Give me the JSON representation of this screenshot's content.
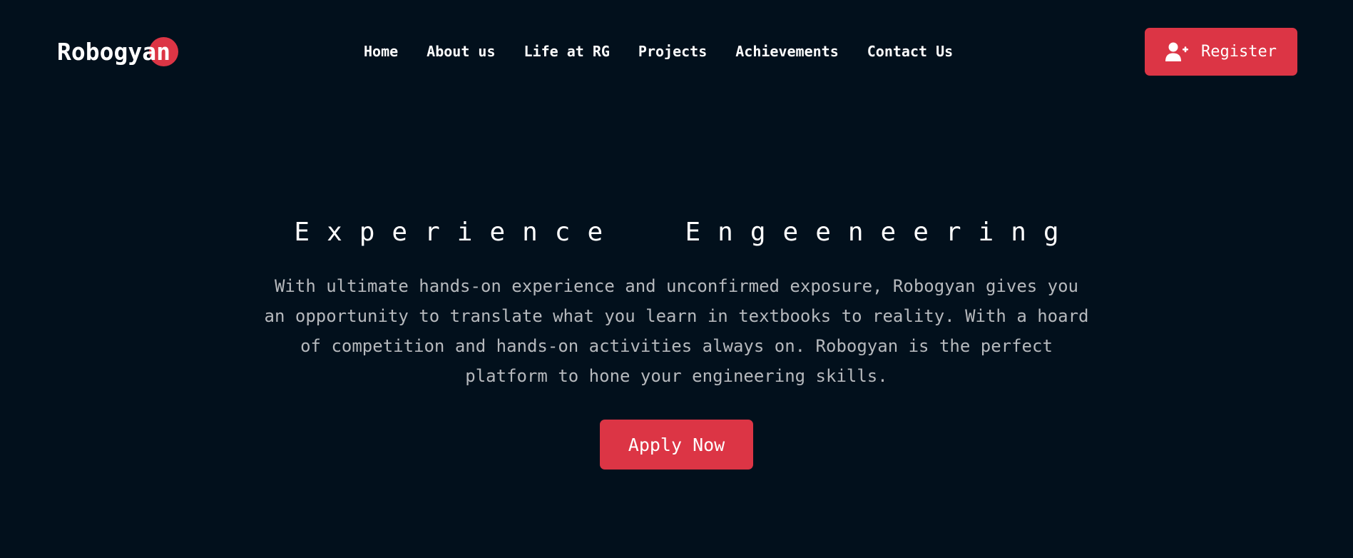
{
  "brand": {
    "name": "Robogyan",
    "accent_color": "#dc3545",
    "background_color": "#02101c"
  },
  "nav": {
    "items": [
      {
        "label": "Home"
      },
      {
        "label": "About us"
      },
      {
        "label": "Life at RG"
      },
      {
        "label": "Projects"
      },
      {
        "label": "Achievements"
      },
      {
        "label": "Contact Us"
      }
    ],
    "register": {
      "label": "Register",
      "icon": "user-plus-icon"
    }
  },
  "hero": {
    "title": "Experience  Engeeneering",
    "text": "With ultimate hands-on experience and unconfirmed exposure, Robogyan gives you an opportunity to translate what you learn in textbooks to reality. With a hoard of competition and hands-on activities always on. Robogyan is the perfect platform to hone your engineering skills.",
    "cta_label": "Apply Now"
  }
}
